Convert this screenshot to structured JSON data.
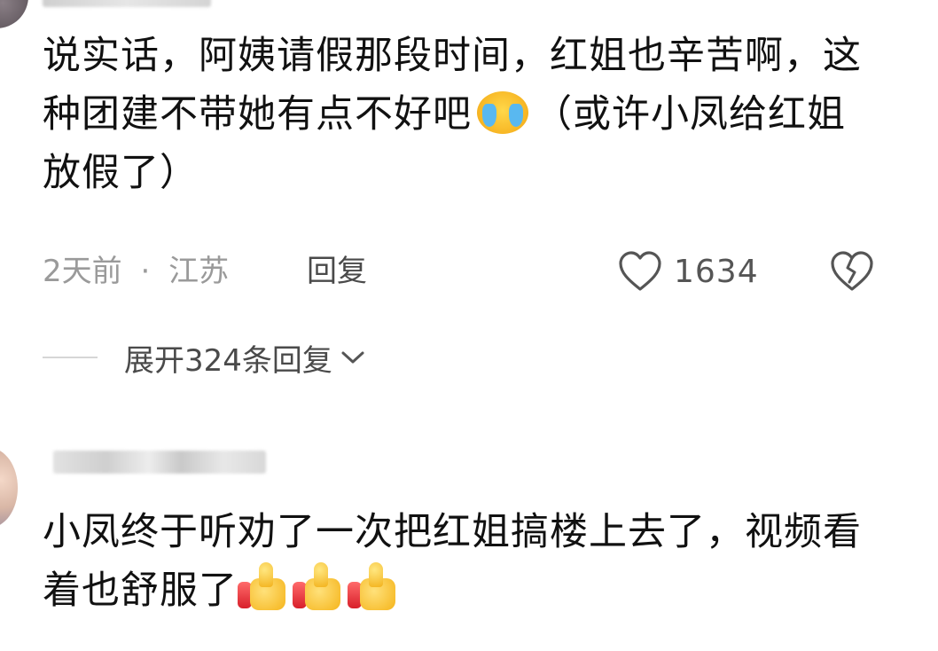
{
  "comment1": {
    "text_before_emoji": "说实话，阿姨请假那段时间，红姐也辛苦啊，这种团建不带她有点不好吧",
    "emoji": "crying-face-emoji",
    "text_after_emoji": "（或许小凤给红姐放假了）",
    "time": "2天前",
    "separator": "·",
    "location": "江苏",
    "reply_label": "回复",
    "like_count": "1634",
    "expand_label": "展开324条回复"
  },
  "comment2": {
    "text": "小凤终于听劝了一次把红姐搞楼上去了，视频看着也舒服了",
    "emojis": [
      "thumbs-up-emoji",
      "thumbs-up-emoji",
      "thumbs-up-emoji"
    ]
  },
  "icons": {
    "like": "heart-outline-icon",
    "dislike": "broken-heart-icon",
    "expand": "chevron-down-icon"
  },
  "colors": {
    "text": "#111111",
    "meta": "#9a9a9a",
    "action": "#4a4a4a"
  }
}
